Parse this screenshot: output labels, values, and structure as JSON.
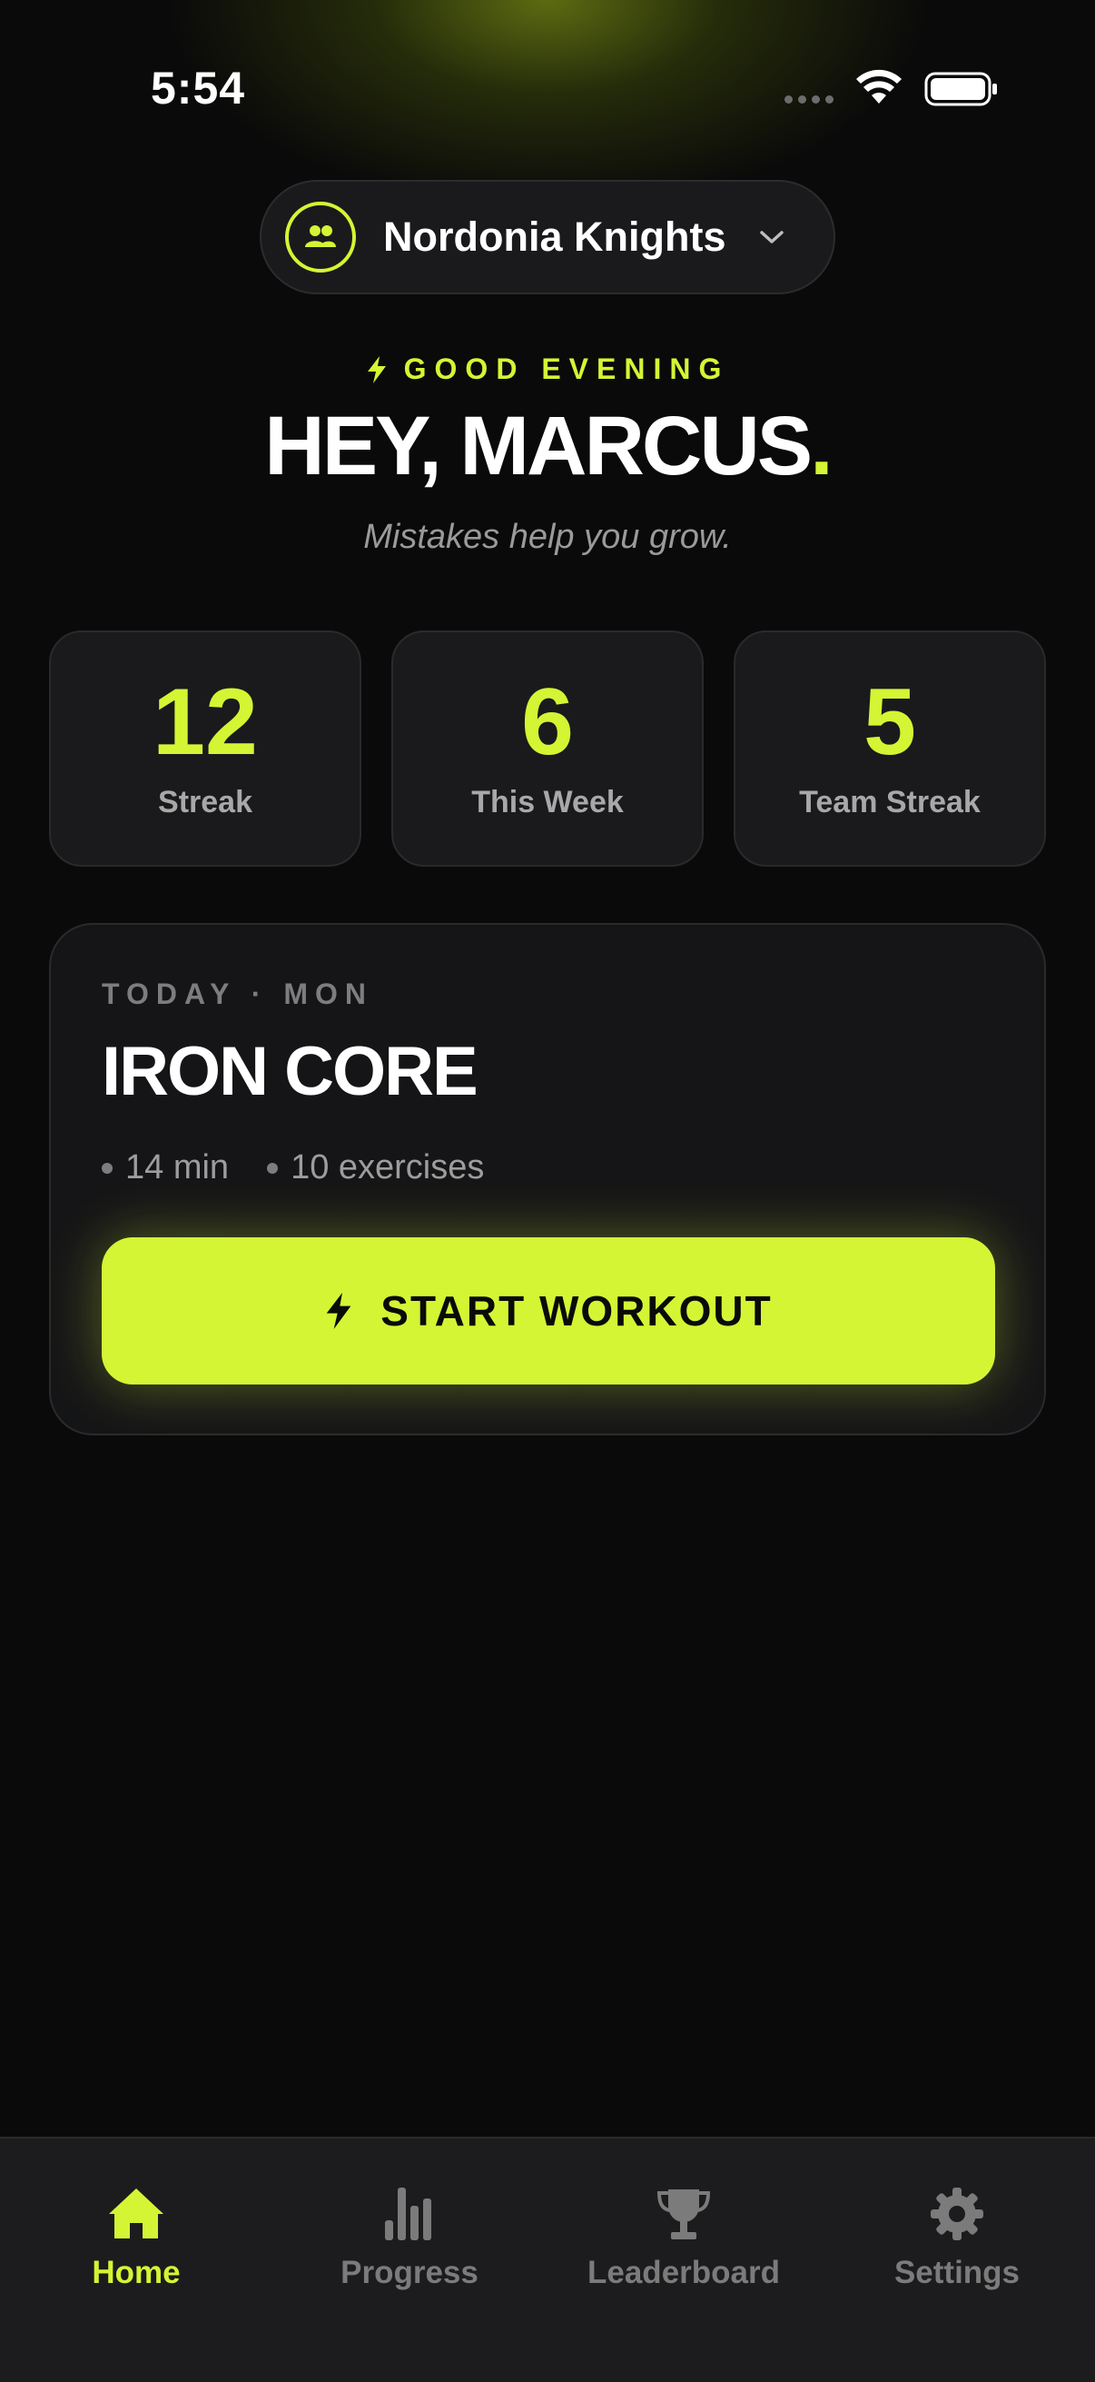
{
  "status_bar": {
    "time": "5:54",
    "icons": [
      "cellular-dots-icon",
      "wifi-icon",
      "battery-icon"
    ]
  },
  "team_selector": {
    "team_name": "Nordonia Knights",
    "icon": "group-icon"
  },
  "greeting": {
    "label": "GOOD EVENING",
    "title_prefix": "HEY, MARCUS",
    "title_dot": ".",
    "tagline": "Mistakes help you grow."
  },
  "stats": [
    {
      "value": "12",
      "label": "Streak"
    },
    {
      "value": "6",
      "label": "This Week"
    },
    {
      "value": "5",
      "label": "Team Streak"
    }
  ],
  "workout": {
    "day_label": "TODAY · MON",
    "title": "IRON CORE",
    "duration": "14 min",
    "exercises": "10 exercises",
    "start_label": "START WORKOUT"
  },
  "tabs": [
    {
      "label": "Home",
      "icon": "home-icon",
      "active": true
    },
    {
      "label": "Progress",
      "icon": "bar-chart-icon",
      "active": false
    },
    {
      "label": "Leaderboard",
      "icon": "trophy-icon",
      "active": false
    },
    {
      "label": "Settings",
      "icon": "gear-icon",
      "active": false
    }
  ],
  "colors": {
    "accent": "#d4f534",
    "background": "#0a0a0a",
    "card": "#1a1a1c",
    "muted_text": "#9a9a9a"
  }
}
